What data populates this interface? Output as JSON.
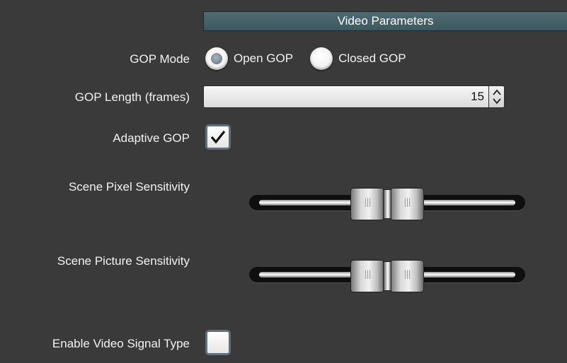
{
  "section": {
    "title": "Video Parameters"
  },
  "gop_mode": {
    "label": "GOP Mode",
    "options": [
      "Open GOP",
      "Closed GOP"
    ],
    "selected": "Open GOP"
  },
  "gop_length": {
    "label": "GOP Length (frames)",
    "value": "15"
  },
  "adaptive_gop": {
    "label": "Adaptive GOP",
    "checked": true
  },
  "scene_pixel_sensitivity": {
    "label": "Scene Pixel Sensitivity",
    "level": 0.5
  },
  "scene_picture_sensitivity": {
    "label": "Scene Picture Sensitivity",
    "level": 0.5
  },
  "enable_video_signal_type": {
    "label": "Enable Video Signal Type",
    "checked": false
  },
  "colors": {
    "background": "#3a3a3a",
    "header": "#456168",
    "checkbox_border": "#5f6f7c",
    "check_mark": "#111111"
  },
  "icons": {
    "spin_up": "chevron-up-icon",
    "spin_down": "chevron-down-icon",
    "check": "checkmark-icon"
  }
}
